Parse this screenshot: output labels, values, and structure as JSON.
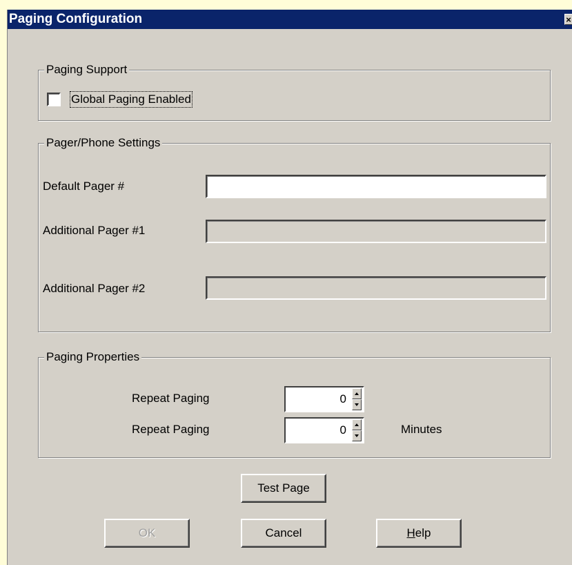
{
  "window": {
    "title": "Paging Configuration",
    "close_glyph": "×"
  },
  "paging_support": {
    "legend": "Paging Support",
    "global_paging_label": "Global Paging Enabled",
    "global_paging_checked": false
  },
  "pager_settings": {
    "legend": "Pager/Phone Settings",
    "default_label": "Default Pager #",
    "default_value": "",
    "additional1_label": "Additional Pager #1",
    "additional1_value": "",
    "additional2_label": "Additional Pager #2",
    "additional2_value": ""
  },
  "paging_properties": {
    "legend": "Paging Properties",
    "repeat1_label": "Repeat Paging",
    "repeat1_value": "0",
    "repeat2_label": "Repeat Paging",
    "repeat2_value": "0",
    "minutes_label": "Minutes"
  },
  "buttons": {
    "test_page": "Test Page",
    "ok": "OK",
    "cancel": "Cancel",
    "help_mnemonic": "H",
    "help_rest": "elp"
  },
  "colors": {
    "titlebar": "#0a246a",
    "dialog_bg": "#d4d0c8",
    "outer_bg": "#fffdd8"
  }
}
